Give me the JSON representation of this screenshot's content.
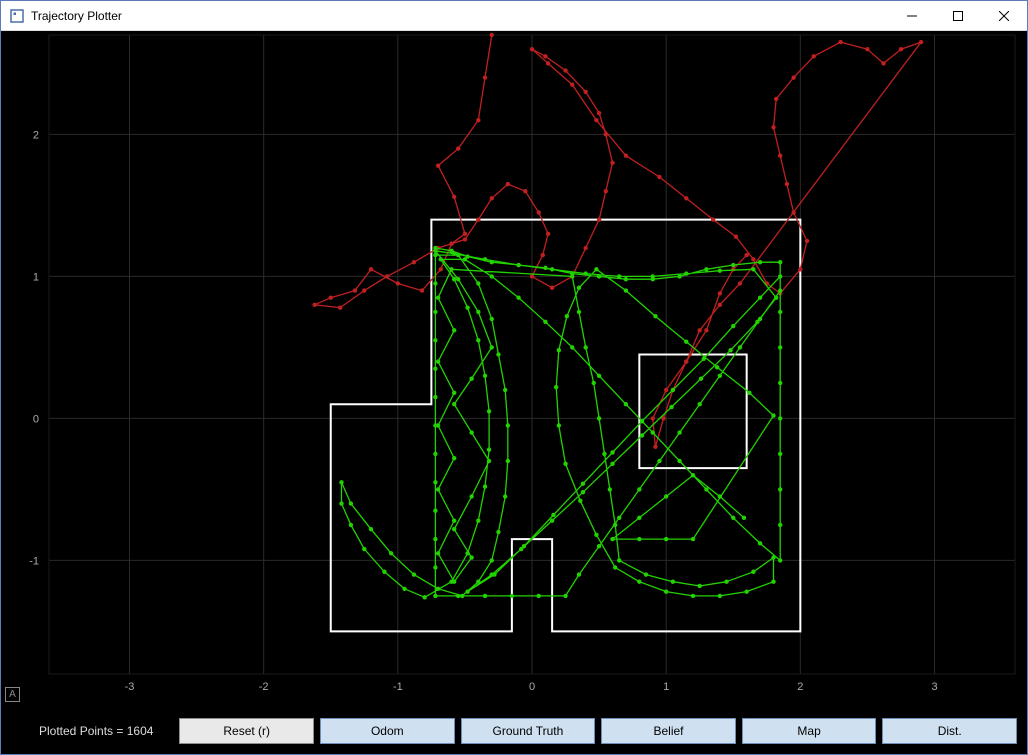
{
  "window": {
    "title": "Trajectory Plotter"
  },
  "status": {
    "label": "Plotted Points = 1604"
  },
  "buttons": {
    "reset": "Reset (r)",
    "odom": "Odom",
    "ground_truth": "Ground Truth",
    "belief": "Belief",
    "map": "Map",
    "dist": "Dist."
  },
  "axes": {
    "x_ticks": [
      -3,
      -2,
      -1,
      0,
      1,
      2,
      3
    ],
    "y_ticks": [
      -1,
      0,
      1,
      2
    ],
    "x_range": [
      -3.6,
      3.6
    ],
    "y_range": [
      -1.8,
      2.7
    ]
  },
  "colors": {
    "odom_trajectory": "#c02020",
    "ground_truth_trajectory": "#22d300",
    "map_outline": "#ffffff",
    "grid": "#2a2a2a",
    "axis_text": "#aaaaaa"
  },
  "chart_data": {
    "type": "line",
    "title": "Trajectory Plotter",
    "xlabel": "",
    "ylabel": "",
    "xlim": [
      -3.6,
      3.6
    ],
    "ylim": [
      -1.8,
      2.7
    ],
    "map_polygons": [
      [
        [
          -1.5,
          -1.5
        ],
        [
          -1.5,
          0.1
        ],
        [
          -0.75,
          0.1
        ],
        [
          -0.75,
          1.4
        ],
        [
          2.0,
          1.4
        ],
        [
          2.0,
          -1.5
        ],
        [
          0.15,
          -1.5
        ],
        [
          0.15,
          -0.85
        ],
        [
          -0.15,
          -0.85
        ],
        [
          -0.15,
          -1.5
        ],
        [
          -1.5,
          -1.5
        ]
      ],
      [
        [
          0.8,
          -0.35
        ],
        [
          1.6,
          -0.35
        ],
        [
          1.6,
          0.45
        ],
        [
          0.8,
          0.45
        ],
        [
          0.8,
          -0.35
        ]
      ]
    ],
    "series": [
      {
        "name": "Odom",
        "color": "#c02020",
        "points": [
          [
            -0.3,
            2.7
          ],
          [
            -0.35,
            2.4
          ],
          [
            -0.4,
            2.1
          ],
          [
            -0.55,
            1.9
          ],
          [
            -0.7,
            1.78
          ],
          [
            -0.58,
            1.56
          ],
          [
            -0.5,
            1.3
          ],
          [
            -0.6,
            1.23
          ],
          [
            -0.68,
            1.05
          ],
          [
            -0.82,
            0.9
          ],
          [
            -1.0,
            0.95
          ],
          [
            -1.2,
            1.05
          ],
          [
            -1.32,
            0.9
          ],
          [
            -1.5,
            0.85
          ],
          [
            -1.62,
            0.8
          ],
          [
            -1.43,
            0.78
          ],
          [
            -1.25,
            0.9
          ],
          [
            -1.08,
            1.0
          ],
          [
            -0.88,
            1.1
          ],
          [
            -0.7,
            1.2
          ],
          [
            -0.5,
            1.26
          ],
          [
            -0.4,
            1.4
          ],
          [
            -0.3,
            1.55
          ],
          [
            -0.18,
            1.65
          ],
          [
            -0.05,
            1.6
          ],
          [
            0.05,
            1.45
          ],
          [
            0.12,
            1.3
          ],
          [
            0.08,
            1.15
          ],
          [
            0.0,
            1.0
          ],
          [
            0.15,
            0.92
          ],
          [
            0.3,
            1.0
          ],
          [
            0.4,
            1.2
          ],
          [
            0.5,
            1.4
          ],
          [
            0.55,
            1.6
          ],
          [
            0.6,
            1.8
          ],
          [
            0.55,
            2.0
          ],
          [
            0.5,
            2.15
          ],
          [
            0.4,
            2.3
          ],
          [
            0.25,
            2.45
          ],
          [
            0.1,
            2.55
          ],
          [
            0.0,
            2.6
          ],
          [
            0.12,
            2.5
          ],
          [
            0.3,
            2.35
          ],
          [
            0.48,
            2.1
          ],
          [
            0.7,
            1.85
          ],
          [
            0.95,
            1.7
          ],
          [
            1.15,
            1.55
          ],
          [
            1.35,
            1.4
          ],
          [
            1.52,
            1.28
          ],
          [
            1.65,
            1.12
          ],
          [
            1.75,
            0.95
          ],
          [
            1.85,
            0.88
          ],
          [
            2.0,
            1.05
          ],
          [
            2.05,
            1.25
          ],
          [
            1.95,
            1.45
          ],
          [
            1.9,
            1.65
          ],
          [
            1.85,
            1.85
          ],
          [
            1.8,
            2.05
          ],
          [
            1.82,
            2.25
          ],
          [
            1.95,
            2.4
          ],
          [
            2.1,
            2.55
          ],
          [
            2.3,
            2.65
          ],
          [
            2.5,
            2.6
          ],
          [
            2.62,
            2.5
          ],
          [
            2.75,
            2.6
          ],
          [
            2.9,
            2.65
          ],
          [
            1.55,
            0.95
          ],
          [
            1.4,
            0.8
          ],
          [
            1.25,
            0.62
          ],
          [
            1.15,
            0.4
          ],
          [
            1.05,
            0.2
          ],
          [
            0.98,
            0.0
          ],
          [
            0.92,
            -0.2
          ],
          [
            0.9,
            0.0
          ],
          [
            1.0,
            0.2
          ],
          [
            1.15,
            0.4
          ],
          [
            1.3,
            0.62
          ],
          [
            1.4,
            0.88
          ],
          [
            1.5,
            1.05
          ],
          [
            1.6,
            1.15
          ]
        ]
      },
      {
        "name": "Ground Truth",
        "color": "#22d300",
        "points": [
          [
            -0.72,
            1.2
          ],
          [
            -0.6,
            1.18
          ],
          [
            -0.48,
            1.14
          ],
          [
            -0.3,
            1.1
          ],
          [
            -0.1,
            1.08
          ],
          [
            0.1,
            1.06
          ],
          [
            0.3,
            1.02
          ],
          [
            0.5,
            1.0
          ],
          [
            0.7,
            0.98
          ],
          [
            0.9,
            0.98
          ],
          [
            1.1,
            1.0
          ],
          [
            1.3,
            1.05
          ],
          [
            1.5,
            1.08
          ],
          [
            1.7,
            1.1
          ],
          [
            1.85,
            1.1
          ],
          [
            1.85,
            0.9
          ],
          [
            1.7,
            0.7
          ],
          [
            1.55,
            0.5
          ],
          [
            1.4,
            0.3
          ],
          [
            1.25,
            0.1
          ],
          [
            1.1,
            -0.1
          ],
          [
            0.95,
            -0.3
          ],
          [
            0.8,
            -0.5
          ],
          [
            0.65,
            -0.7
          ],
          [
            0.5,
            -0.9
          ],
          [
            0.35,
            -1.1
          ],
          [
            0.25,
            -1.25
          ],
          [
            0.05,
            -1.25
          ],
          [
            -0.15,
            -1.25
          ],
          [
            -0.35,
            -1.25
          ],
          [
            -0.55,
            -1.25
          ],
          [
            -0.72,
            -1.25
          ],
          [
            -0.72,
            -1.05
          ],
          [
            -0.72,
            -0.85
          ],
          [
            -0.72,
            -0.65
          ],
          [
            -0.72,
            -0.45
          ],
          [
            -0.72,
            -0.25
          ],
          [
            -0.72,
            -0.05
          ],
          [
            -0.72,
            0.15
          ],
          [
            -0.72,
            0.35
          ],
          [
            -0.72,
            0.55
          ],
          [
            -0.72,
            0.75
          ],
          [
            -0.72,
            0.95
          ],
          [
            -0.72,
            1.15
          ],
          [
            -0.55,
            1.15
          ],
          [
            -0.4,
            0.95
          ],
          [
            -0.3,
            0.7
          ],
          [
            -0.25,
            0.45
          ],
          [
            -0.2,
            0.2
          ],
          [
            -0.18,
            -0.05
          ],
          [
            -0.18,
            -0.3
          ],
          [
            -0.2,
            -0.55
          ],
          [
            -0.25,
            -0.8
          ],
          [
            -0.3,
            -1.0
          ],
          [
            -0.4,
            -1.15
          ],
          [
            -0.52,
            -1.25
          ],
          [
            -0.7,
            -1.2
          ],
          [
            -0.88,
            -1.1
          ],
          [
            -1.05,
            -0.95
          ],
          [
            -1.2,
            -0.78
          ],
          [
            -1.35,
            -0.6
          ],
          [
            -1.42,
            -0.45
          ],
          [
            -1.42,
            -0.6
          ],
          [
            -1.35,
            -0.75
          ],
          [
            -1.25,
            -0.92
          ],
          [
            -1.1,
            -1.08
          ],
          [
            -0.95,
            -1.2
          ],
          [
            -0.8,
            -1.26
          ],
          [
            -0.6,
            -1.15
          ],
          [
            -0.48,
            -0.95
          ],
          [
            -0.4,
            -0.72
          ],
          [
            -0.35,
            -0.48
          ],
          [
            -0.32,
            -0.22
          ],
          [
            -0.32,
            0.05
          ],
          [
            -0.35,
            0.3
          ],
          [
            -0.4,
            0.55
          ],
          [
            -0.48,
            0.78
          ],
          [
            -0.58,
            0.98
          ],
          [
            -0.68,
            1.12
          ],
          [
            -0.5,
            1.12
          ],
          [
            -0.3,
            1.0
          ],
          [
            -0.1,
            0.85
          ],
          [
            0.1,
            0.68
          ],
          [
            0.3,
            0.5
          ],
          [
            0.5,
            0.3
          ],
          [
            0.7,
            0.1
          ],
          [
            0.9,
            -0.1
          ],
          [
            1.1,
            -0.3
          ],
          [
            1.3,
            -0.5
          ],
          [
            1.5,
            -0.7
          ],
          [
            1.7,
            -0.88
          ],
          [
            1.85,
            -1.0
          ],
          [
            1.85,
            -0.75
          ],
          [
            1.85,
            -0.5
          ],
          [
            1.85,
            -0.25
          ],
          [
            1.85,
            0.0
          ],
          [
            1.85,
            0.25
          ],
          [
            1.85,
            0.5
          ],
          [
            1.85,
            0.75
          ],
          [
            1.85,
            1.0
          ],
          [
            1.7,
            0.85
          ],
          [
            1.5,
            0.65
          ],
          [
            1.28,
            0.42
          ],
          [
            1.05,
            0.2
          ],
          [
            0.82,
            -0.02
          ],
          [
            0.6,
            -0.24
          ],
          [
            0.38,
            -0.46
          ],
          [
            0.16,
            -0.68
          ],
          [
            -0.06,
            -0.9
          ],
          [
            -0.28,
            -1.1
          ],
          [
            -0.48,
            -1.22
          ],
          [
            -0.3,
            -1.1
          ],
          [
            -0.08,
            -0.92
          ],
          [
            0.15,
            -0.72
          ],
          [
            0.38,
            -0.52
          ],
          [
            0.6,
            -0.32
          ],
          [
            0.82,
            -0.12
          ],
          [
            1.04,
            0.08
          ],
          [
            1.26,
            0.28
          ],
          [
            1.48,
            0.48
          ],
          [
            1.68,
            0.68
          ],
          [
            1.82,
            0.85
          ],
          [
            1.65,
            1.05
          ],
          [
            1.4,
            1.04
          ],
          [
            1.15,
            1.02
          ],
          [
            0.9,
            1.0
          ],
          [
            0.65,
            1.0
          ],
          [
            0.4,
            1.02
          ],
          [
            0.15,
            1.05
          ],
          [
            -0.1,
            1.08
          ],
          [
            -0.35,
            1.12
          ],
          [
            -0.58,
            1.16
          ],
          [
            -0.72,
            1.18
          ],
          [
            -0.55,
            0.98
          ],
          [
            -0.4,
            0.75
          ],
          [
            -0.3,
            0.5
          ],
          [
            -0.45,
            0.28
          ],
          [
            -0.58,
            0.1
          ],
          [
            -0.45,
            -0.1
          ],
          [
            -0.32,
            -0.3
          ],
          [
            -0.45,
            -0.55
          ],
          [
            -0.58,
            -0.78
          ],
          [
            -0.45,
            -0.98
          ],
          [
            -0.58,
            -1.15
          ],
          [
            -0.7,
            -0.95
          ],
          [
            -0.58,
            -0.72
          ],
          [
            -0.7,
            -0.5
          ],
          [
            -0.58,
            -0.28
          ],
          [
            -0.7,
            -0.05
          ],
          [
            -0.58,
            0.18
          ],
          [
            -0.7,
            0.4
          ],
          [
            -0.58,
            0.62
          ],
          [
            -0.7,
            0.85
          ],
          [
            -0.6,
            1.05
          ],
          [
            0.3,
            1.0
          ],
          [
            0.35,
            0.75
          ],
          [
            0.4,
            0.5
          ],
          [
            0.46,
            0.25
          ],
          [
            0.5,
            0.0
          ],
          [
            0.54,
            -0.25
          ],
          [
            0.58,
            -0.5
          ],
          [
            0.62,
            -0.75
          ],
          [
            0.65,
            -1.0
          ],
          [
            0.85,
            -1.1
          ],
          [
            1.05,
            -1.15
          ],
          [
            1.25,
            -1.18
          ],
          [
            1.45,
            -1.15
          ],
          [
            1.65,
            -1.08
          ],
          [
            1.8,
            -0.98
          ],
          [
            1.8,
            -1.15
          ],
          [
            1.6,
            -1.22
          ],
          [
            1.4,
            -1.25
          ],
          [
            1.2,
            -1.25
          ],
          [
            1.0,
            -1.22
          ],
          [
            0.8,
            -1.15
          ],
          [
            0.62,
            -1.05
          ],
          [
            0.48,
            -0.82
          ],
          [
            0.36,
            -0.58
          ],
          [
            0.25,
            -0.32
          ],
          [
            0.2,
            -0.05
          ],
          [
            0.18,
            0.22
          ],
          [
            0.2,
            0.48
          ],
          [
            0.26,
            0.72
          ],
          [
            0.35,
            0.92
          ],
          [
            0.48,
            1.05
          ],
          [
            0.7,
            0.9
          ],
          [
            0.92,
            0.72
          ],
          [
            1.15,
            0.54
          ],
          [
            1.38,
            0.36
          ],
          [
            1.62,
            0.18
          ],
          [
            1.8,
            0.02
          ],
          [
            1.2,
            -0.85
          ],
          [
            1.0,
            -0.85
          ],
          [
            0.8,
            -0.85
          ],
          [
            0.6,
            -0.85
          ],
          [
            0.8,
            -0.7
          ],
          [
            1.0,
            -0.55
          ],
          [
            1.2,
            -0.4
          ],
          [
            1.4,
            -0.55
          ],
          [
            1.58,
            -0.7
          ]
        ]
      }
    ]
  }
}
